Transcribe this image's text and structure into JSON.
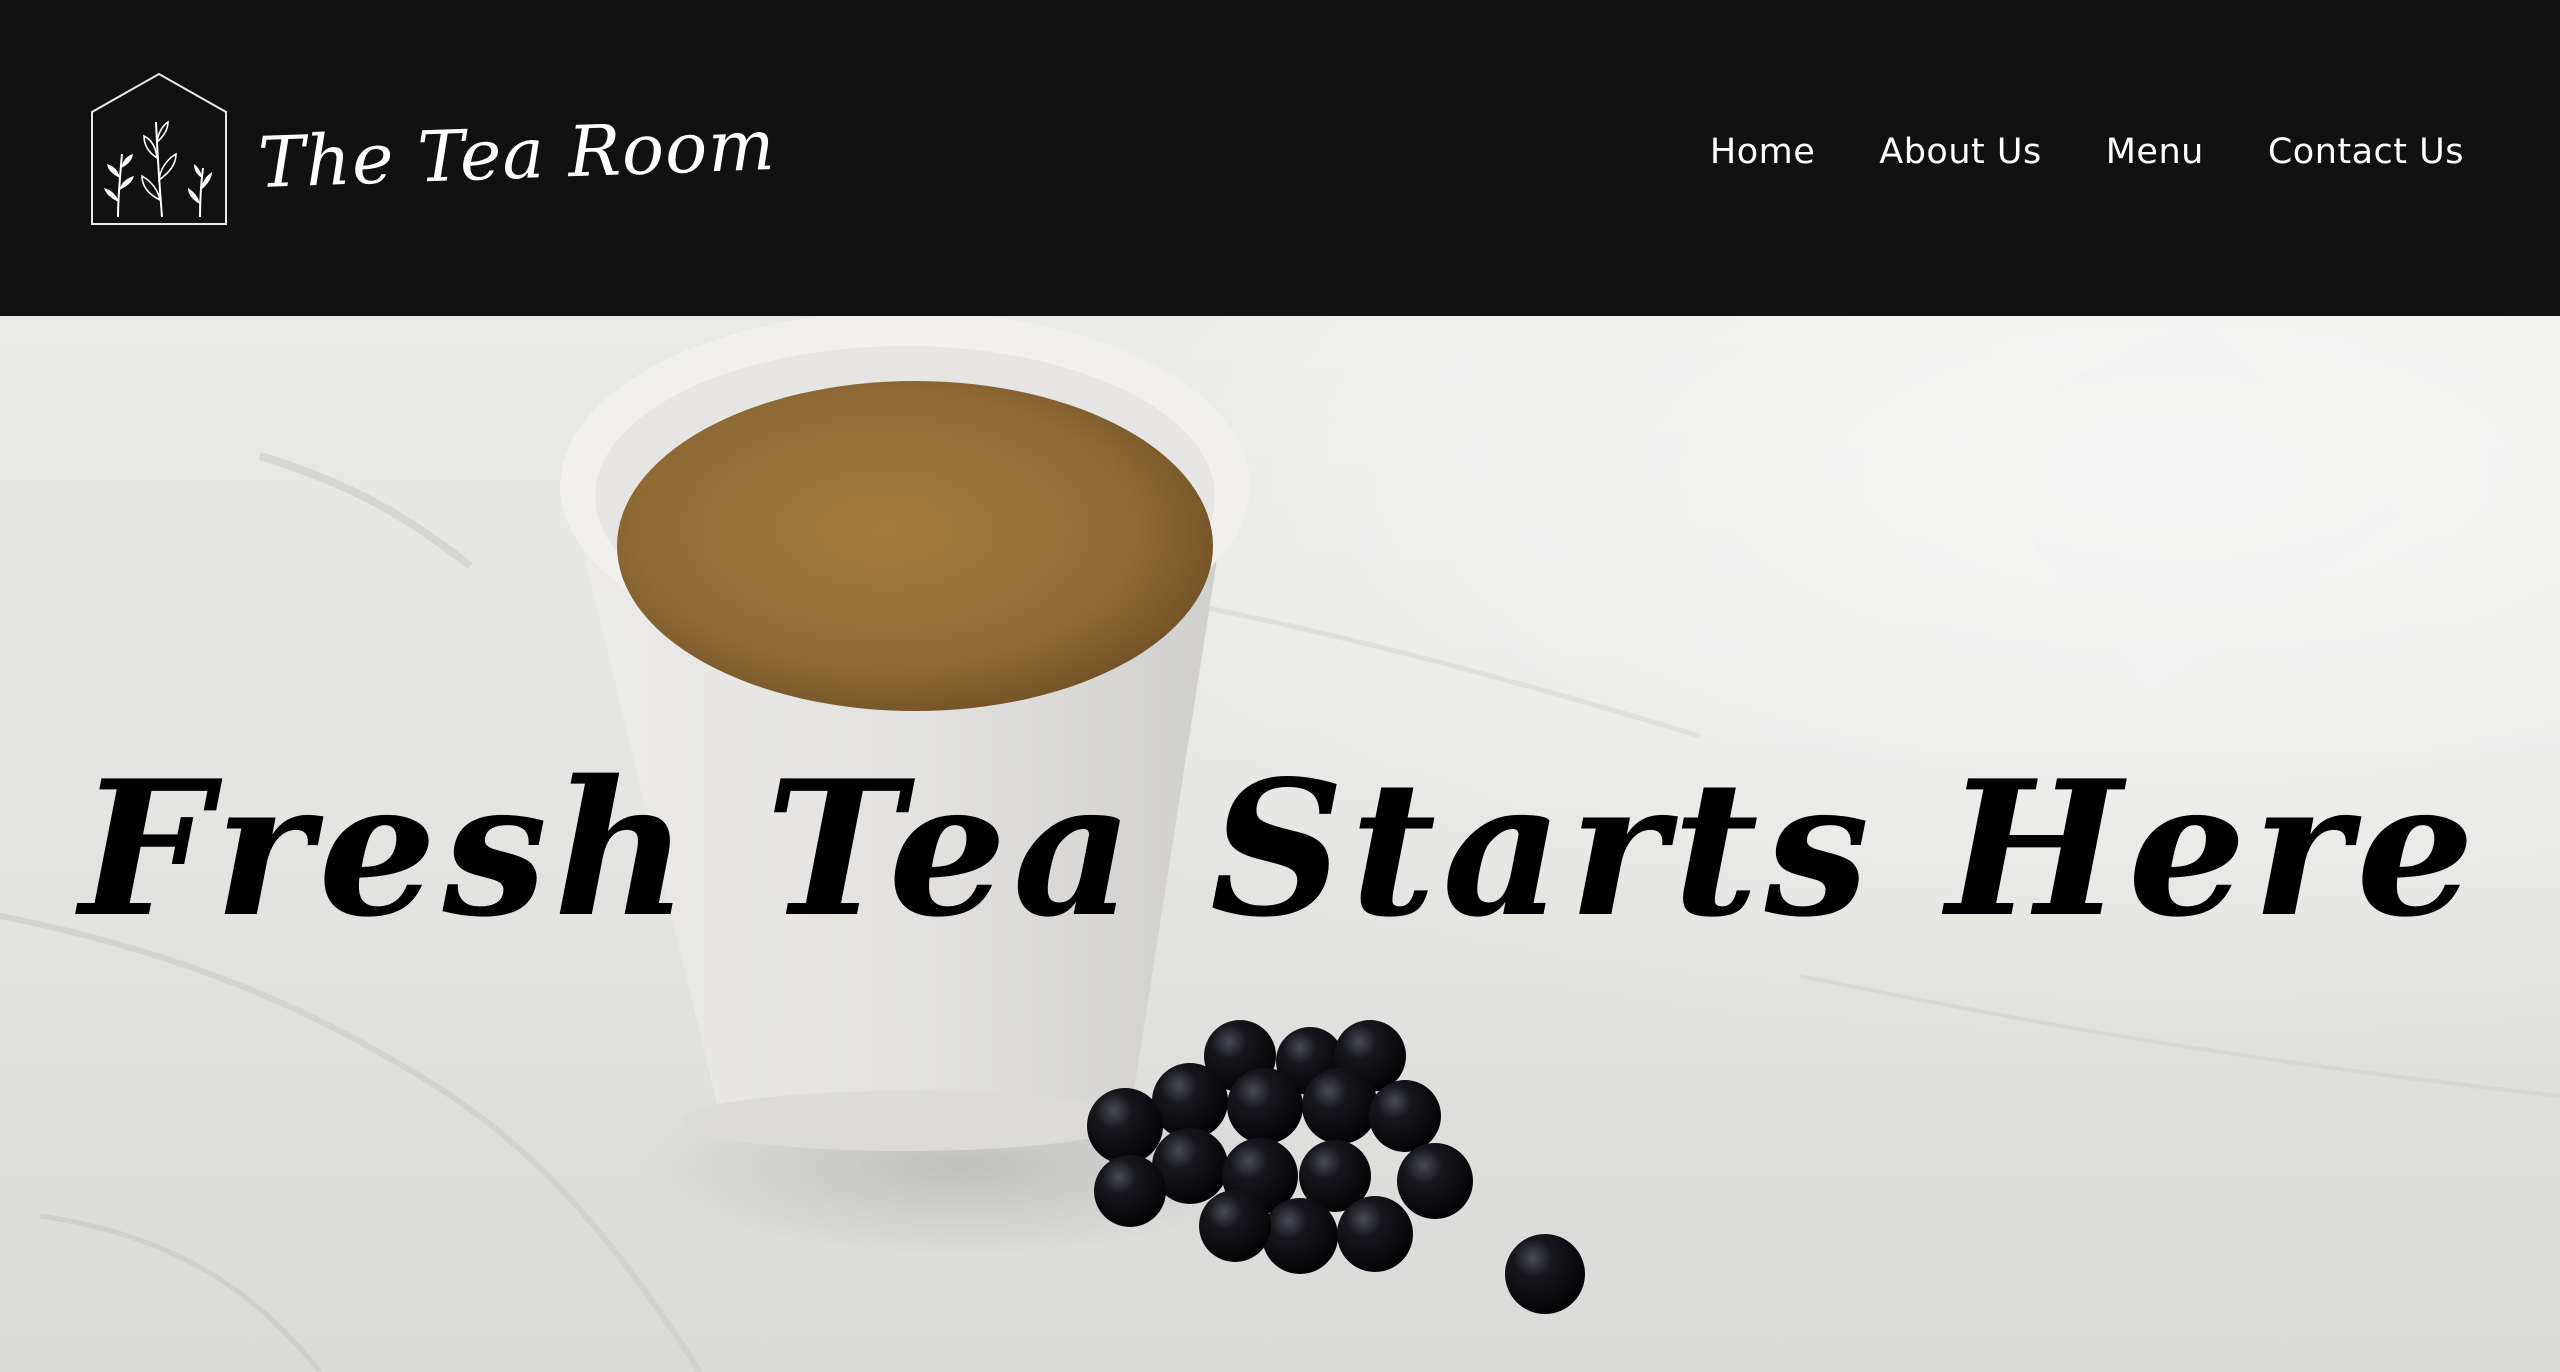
{
  "brand": {
    "name": "The Tea Room",
    "logo_icon": "house-with-plants-icon"
  },
  "nav": {
    "items": [
      {
        "label": "Home"
      },
      {
        "label": "About Us"
      },
      {
        "label": "Menu"
      },
      {
        "label": "Contact Us"
      }
    ]
  },
  "hero": {
    "heading": "Fresh Tea Starts Here",
    "image": "tea-cup-with-boba-photo"
  },
  "colors": {
    "header_bg": "#111111",
    "nav_text": "#ffffff",
    "heading_text": "#000000"
  }
}
